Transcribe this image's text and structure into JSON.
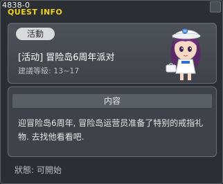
{
  "window": {
    "quest_id": "4838-0",
    "title": "QUEST INFO"
  },
  "quest": {
    "tag": "活動",
    "name": "[活动] 冒险岛6周年派对",
    "level": "建議等級: 13~17"
  },
  "content": {
    "header": "内容",
    "description": "迎冒险岛6周年, 冒险岛运营员准备了特别的戒指礼物. 去找他看看吧."
  },
  "status": "狀態: 可開始",
  "icons": {
    "portrait": "npc-portrait-icon"
  },
  "colors": {
    "title": "#f2d21b",
    "background": "#2b2e33"
  }
}
